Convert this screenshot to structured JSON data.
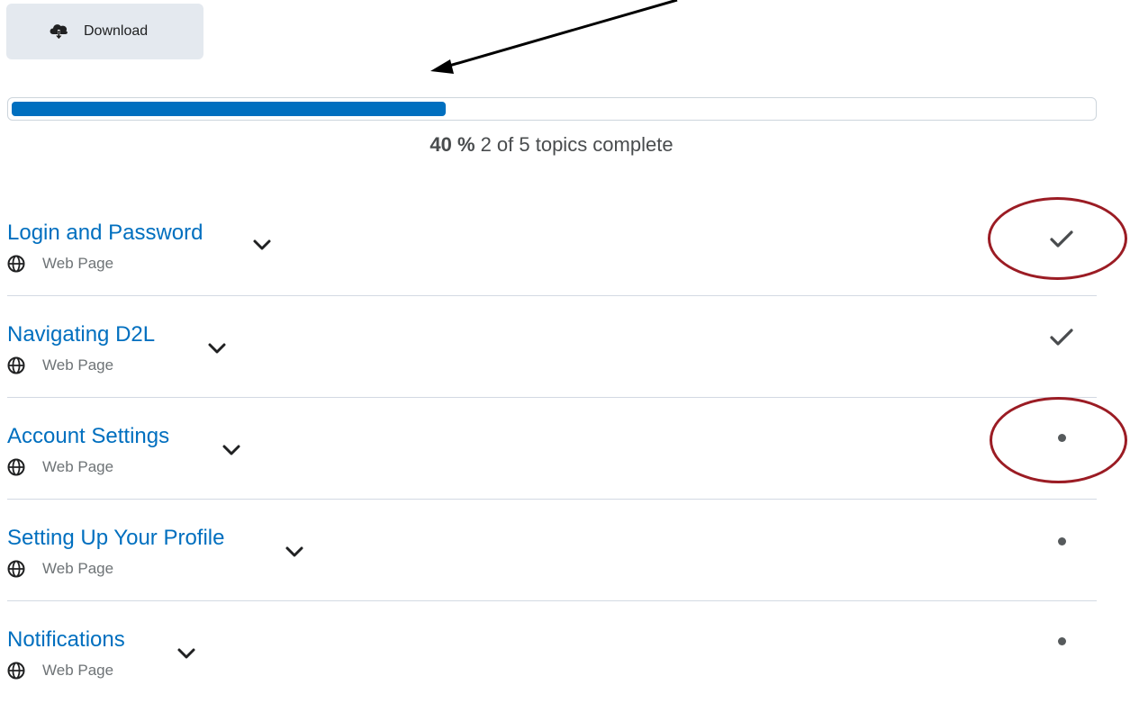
{
  "toolbar": {
    "download_label": "Download"
  },
  "progress": {
    "fraction": 0.4,
    "percent_label": "40 %",
    "summary": "2 of 5 topics complete"
  },
  "topics": [
    {
      "title": "Login and Password",
      "type": "Web Page",
      "status": "complete"
    },
    {
      "title": "Navigating D2L",
      "type": "Web Page",
      "status": "complete"
    },
    {
      "title": "Account Settings",
      "type": "Web Page",
      "status": "incomplete"
    },
    {
      "title": "Setting Up Your Profile",
      "type": "Web Page",
      "status": "incomplete"
    },
    {
      "title": "Notifications",
      "type": "Web Page",
      "status": "incomplete"
    }
  ],
  "colors": {
    "accent": "#006fbf",
    "button_bg": "#e4e9ef",
    "annotation": "#9b1c24"
  },
  "icons": {
    "download": "cloud-download-icon",
    "chevron": "chevron-down-icon",
    "type": "globe-icon",
    "complete": "checkmark-icon",
    "incomplete": "dot-icon"
  }
}
